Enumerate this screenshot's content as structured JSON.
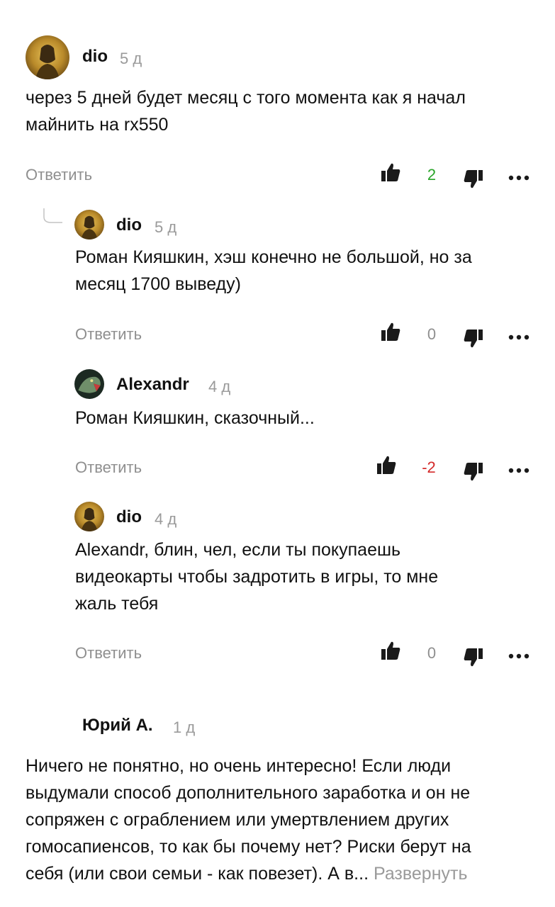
{
  "comments": [
    {
      "author": "dio",
      "time": "5 д",
      "text_lines": [
        "через 5 дней будет месяц с того момента как я начал",
        "майнить на rx550"
      ],
      "reply_label": "Ответить",
      "votes": "2"
    },
    {
      "author": "dio",
      "time": "5 д",
      "text_lines": [
        "Роман Кияшкин, хэш конечно не большой, но за",
        "месяц 1700 выведу)"
      ],
      "reply_label": "Ответить",
      "votes": "0"
    },
    {
      "author": "Alexandr",
      "time": "4 д",
      "text_lines": [
        "Роман Кияшкин, сказочный..."
      ],
      "reply_label": "Ответить",
      "votes": "-2"
    },
    {
      "author": "dio",
      "time": "4 д",
      "text_lines": [
        "Alexandr, блин, чел, если ты покупаешь",
        "видеокарты чтобы задротить в игры, то мне",
        "жаль тебя"
      ],
      "reply_label": "Ответить",
      "votes": "0"
    },
    {
      "author": "Юрий А.",
      "time": "1 д",
      "text_lines": [
        "Ничего не понятно, но очень интересно! Если люди",
        "выдумали способ дополнительного заработка и он не",
        "сопряжен с ограблением или умертвлением других",
        "гомосапиенсов, то как бы почему нет? Риски берут на",
        "себя (или свои семьи - как повезет). А в..."
      ],
      "expand_label": "Развернуть"
    }
  ],
  "colors": {
    "positive": "#2aa52a",
    "negative": "#d42a2a",
    "neutral": "#8f8f8f",
    "icon": "#1a1a1a"
  },
  "icons": {
    "like": "thumbs-up-icon",
    "dislike": "thumbs-down-icon",
    "more": "more-dots-icon",
    "thread": "reply-thread-connector"
  }
}
